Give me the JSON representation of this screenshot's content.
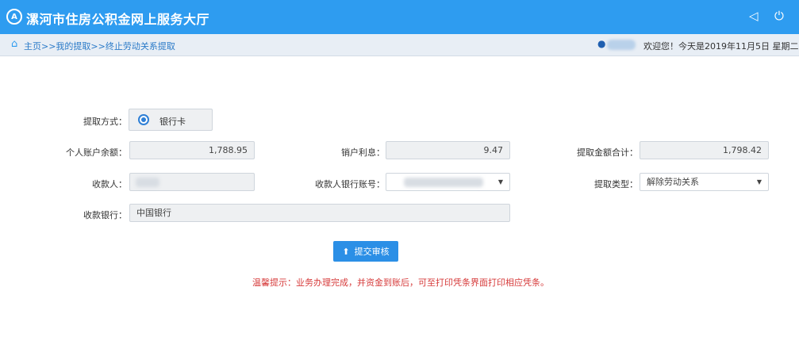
{
  "header": {
    "logo_glyph": "A",
    "title": "漯河市住房公积金网上服务大厅",
    "speaker_icon": "speaker-icon",
    "power_icon": "power-icon"
  },
  "subbar": {
    "breadcrumb": "主页>>我的提取>>终止劳动关系提取",
    "welcome": "欢迎您！今天是2019年11月5日 星期二"
  },
  "form": {
    "method_label": "提取方式：",
    "method_option": "银行卡",
    "balance_label": "个人账户余额：",
    "balance_value": "1,788.95",
    "interest_label": "销户利息：",
    "interest_value": "9.47",
    "total_label": "提取金额合计：",
    "total_value": "1,798.42",
    "payee_label": "收款人：",
    "payee_account_label": "收款人银行账号：",
    "type_label": "提取类型：",
    "type_value": "解除劳动关系",
    "bank_label": "收款银行：",
    "bank_value": "中国银行",
    "submit_label": "提交审核",
    "tip": "温馨提示：业务办理完成，并资金到账后，可至打印凭条界面打印相应凭条。"
  },
  "colors": {
    "header_bg": "#2e9cf0",
    "submit_bg": "#2b8fe6",
    "tip_text": "#d63a3a"
  }
}
